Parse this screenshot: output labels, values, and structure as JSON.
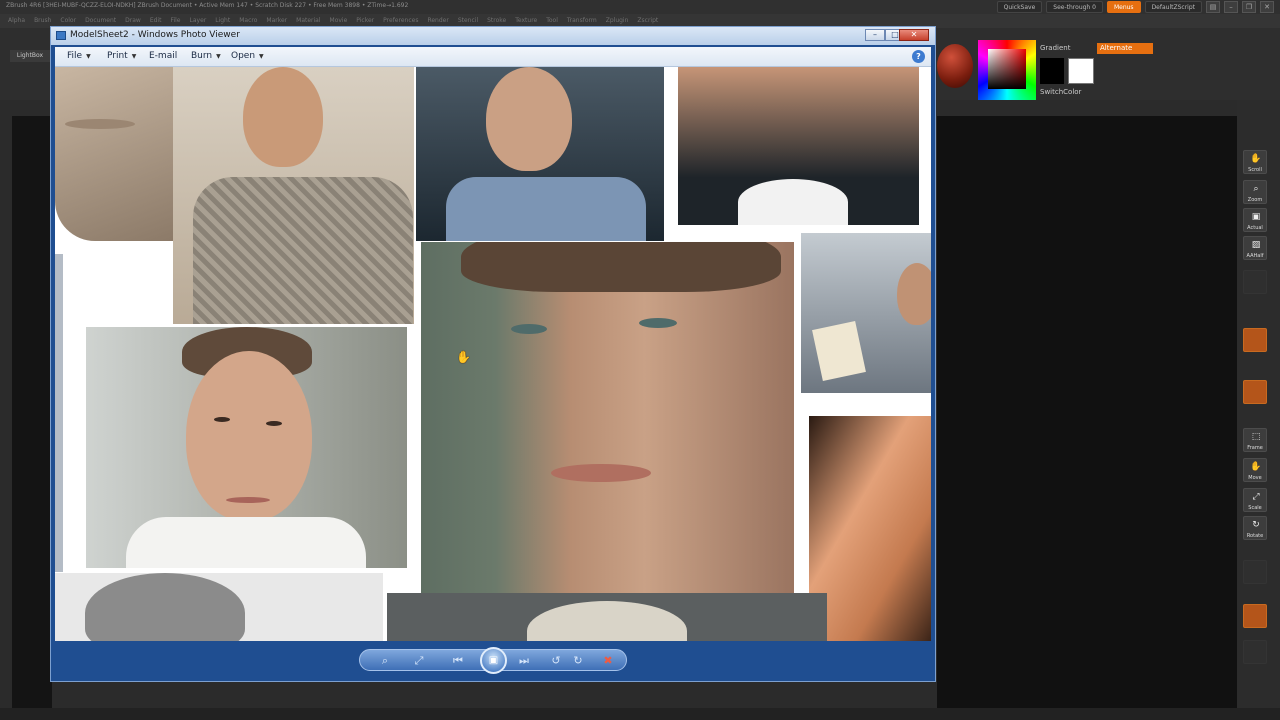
{
  "zbrush": {
    "title_bar": "ZBrush 4R6  [3HEI-MUBF-QCZZ-ELOI-NDKH]   ZBrush Document    • Active Mem 147 • Scratch Disk 227 • Free Mem 3898 • ZTime→1.692",
    "menu_items": [
      "Alpha",
      "Brush",
      "Color",
      "Document",
      "Draw",
      "Edit",
      "File",
      "Layer",
      "Light",
      "Macro",
      "Marker",
      "Material",
      "Movie",
      "Picker",
      "Preferences",
      "Render",
      "Stencil",
      "Stroke",
      "Texture",
      "Tool",
      "Transform",
      "Zplugin",
      "Zscript"
    ],
    "quicksave": "QuickSave",
    "see_through": "See-through  0",
    "menus": "Menus",
    "default_zscript": "DefaultZScript",
    "lightbox": "LightBox",
    "gradient": "Gradient",
    "switch_color": "SwitchColor",
    "alternate": "Alternate",
    "right_tray": [
      {
        "label": "Scroll",
        "icon": "✋"
      },
      {
        "label": "Zoom",
        "icon": "⌕"
      },
      {
        "label": "Actual",
        "icon": "▣"
      },
      {
        "label": "AAHalf",
        "icon": "▨"
      },
      {
        "label": "Frame",
        "icon": "⬚"
      },
      {
        "label": "Move",
        "icon": "✋"
      },
      {
        "label": "Scale",
        "icon": "⤢"
      },
      {
        "label": "Rotate",
        "icon": "↻"
      }
    ],
    "colors": {
      "accent": "#e66f10",
      "panel": "#2e2e2e",
      "canvas": "#111111"
    }
  },
  "photo_viewer": {
    "title": "ModelSheet2 - Windows Photo Viewer",
    "menus": [
      {
        "label": "File",
        "has_arrow": true
      },
      {
        "label": "Print",
        "has_arrow": true
      },
      {
        "label": "E-mail",
        "has_arrow": false
      },
      {
        "label": "Burn",
        "has_arrow": true
      },
      {
        "label": "Open",
        "has_arrow": true
      }
    ],
    "help": "?",
    "toolbar": {
      "zoom": "⌕",
      "fit": "⤢",
      "previous": "⏮",
      "slideshow": "▣",
      "next": "⏭",
      "rotate_ccw": "↺",
      "rotate_cw": "↻",
      "delete": "✖"
    },
    "colors": {
      "frame": "#1f4e91",
      "title_bg": "#dbe7f6",
      "toolbar": "#3e6fb6",
      "delete": "#ef5b43"
    }
  }
}
